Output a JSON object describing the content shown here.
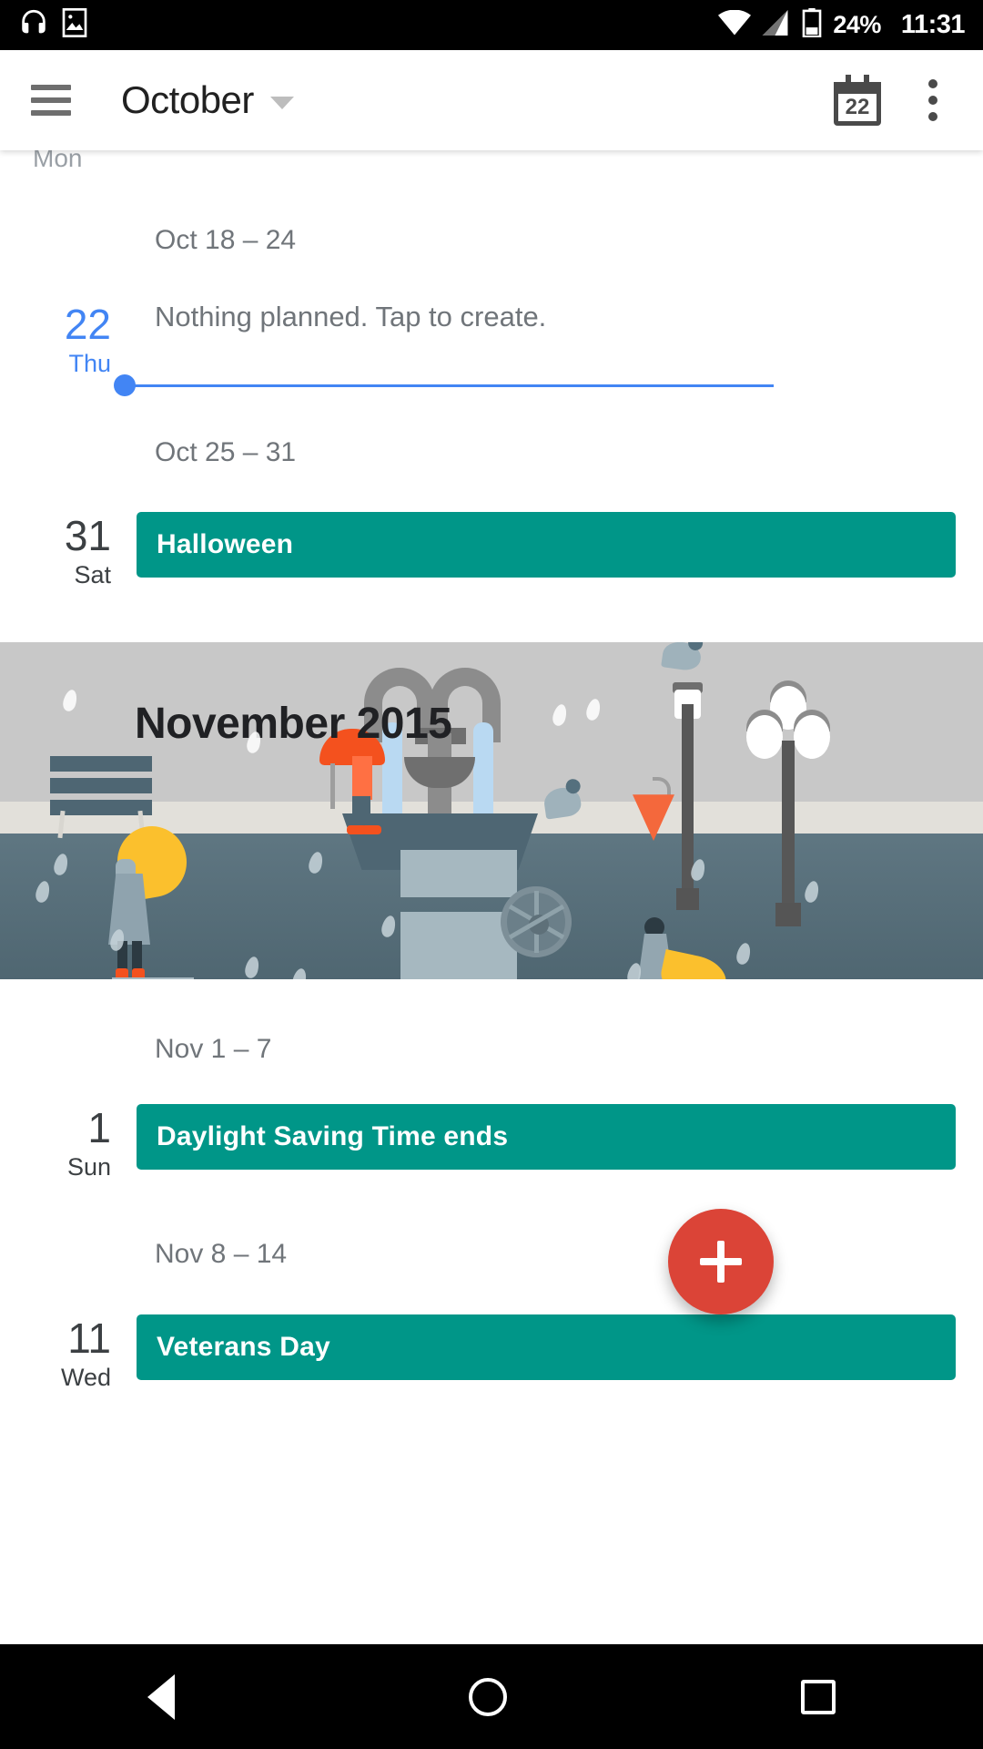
{
  "statusbar": {
    "icons": [
      "headphones-icon",
      "screenshot-icon",
      "wifi-icon",
      "signal-icon",
      "battery-icon"
    ],
    "battery_percent": "24%",
    "time": "11:31"
  },
  "toolbar": {
    "menu_icon": "hamburger-menu-icon",
    "title": "October",
    "dropdown_icon": "chevron-down-icon",
    "today_icon_day": "22",
    "overflow_icon": "overflow-menu-icon"
  },
  "schedule": {
    "cut_off_weekday_top": "Mon",
    "week1_header": "Oct 18 – 24",
    "today": {
      "day": "22",
      "weekday": "Thu",
      "empty_text": "Nothing planned. Tap to create."
    },
    "week2_header": "Oct 25 – 31",
    "halloween": {
      "day": "31",
      "weekday": "Sat",
      "title": "Halloween"
    },
    "week3_header": "Nov 1 – 7",
    "dst": {
      "day": "1",
      "weekday": "Sun",
      "title": "Daylight Saving Time ends"
    },
    "week4_header": "Nov 8 – 14",
    "veterans": {
      "day": "11",
      "weekday": "Wed",
      "title": "Veterans Day"
    }
  },
  "month_art": {
    "title": "November 2015",
    "scene": "rainy-city-fountain-illustration"
  },
  "fab": {
    "label": "+",
    "name": "create-event-button"
  },
  "navbar": {
    "back": "back-icon",
    "home": "home-icon",
    "recents": "recents-icon"
  },
  "colors": {
    "today_blue": "#4285f4",
    "event_teal": "#009688",
    "fab_red": "#db4437",
    "text_secondary": "#70757a"
  }
}
